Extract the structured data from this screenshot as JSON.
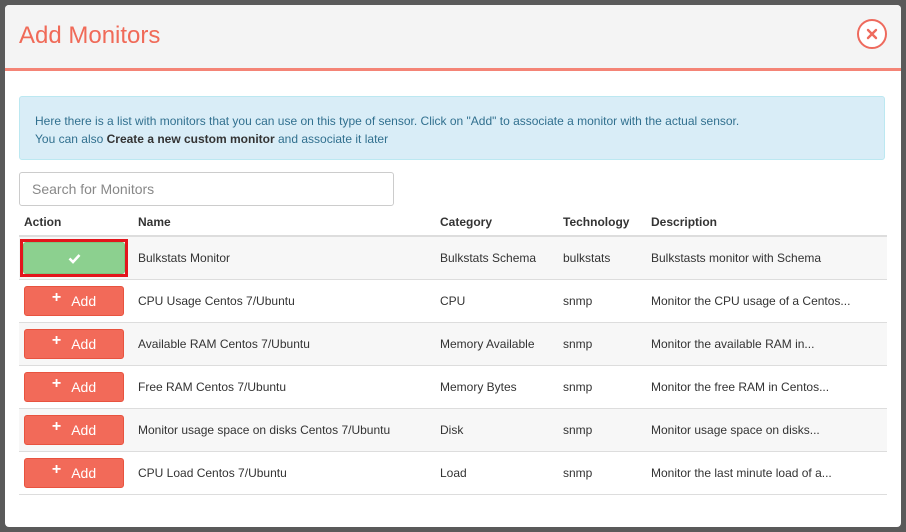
{
  "modal": {
    "title": "Add Monitors"
  },
  "info": {
    "line1": "Here there is a list with monitors that you can use on this type of sensor. Click on \"Add\" to associate a monitor with the actual sensor.",
    "line2_prefix": "You can also ",
    "line2_bold": "Create a new custom monitor",
    "line2_suffix": " and associate it later"
  },
  "search": {
    "placeholder": "Search for Monitors"
  },
  "table": {
    "headers": {
      "action": "Action",
      "name": "Name",
      "category": "Category",
      "technology": "Technology",
      "description": "Description"
    },
    "add_label": "Add",
    "rows": [
      {
        "name": "Bulkstats Monitor",
        "category": "Bulkstats Schema",
        "technology": "bulkstats",
        "description": "Bulkstasts monitor with Schema",
        "added": true
      },
      {
        "name": "CPU Usage Centos 7/Ubuntu",
        "category": "CPU",
        "technology": "snmp",
        "description": "Monitor the CPU usage of a Centos...",
        "added": false
      },
      {
        "name": "Available RAM Centos 7/Ubuntu",
        "category": "Memory Available",
        "technology": "snmp",
        "description": "Monitor the available RAM in...",
        "added": false
      },
      {
        "name": "Free RAM Centos 7/Ubuntu",
        "category": "Memory Bytes",
        "technology": "snmp",
        "description": "Monitor the free RAM in Centos...",
        "added": false
      },
      {
        "name": "Monitor usage space on disks Centos 7/Ubuntu",
        "category": "Disk",
        "technology": "snmp",
        "description": "Monitor usage space on disks...",
        "added": false
      },
      {
        "name": "CPU Load Centos 7/Ubuntu",
        "category": "Load",
        "technology": "snmp",
        "description": "Monitor the last minute load of a...",
        "added": false
      }
    ]
  },
  "colors": {
    "accent": "#f06a58",
    "add_button": "#f26a59",
    "added_button": "#8cd08f",
    "info_bg": "#d9edf7",
    "highlight": "#e3151c"
  },
  "icons": {
    "close": "close-icon",
    "add": "plus-icon",
    "added": "check-icon"
  }
}
